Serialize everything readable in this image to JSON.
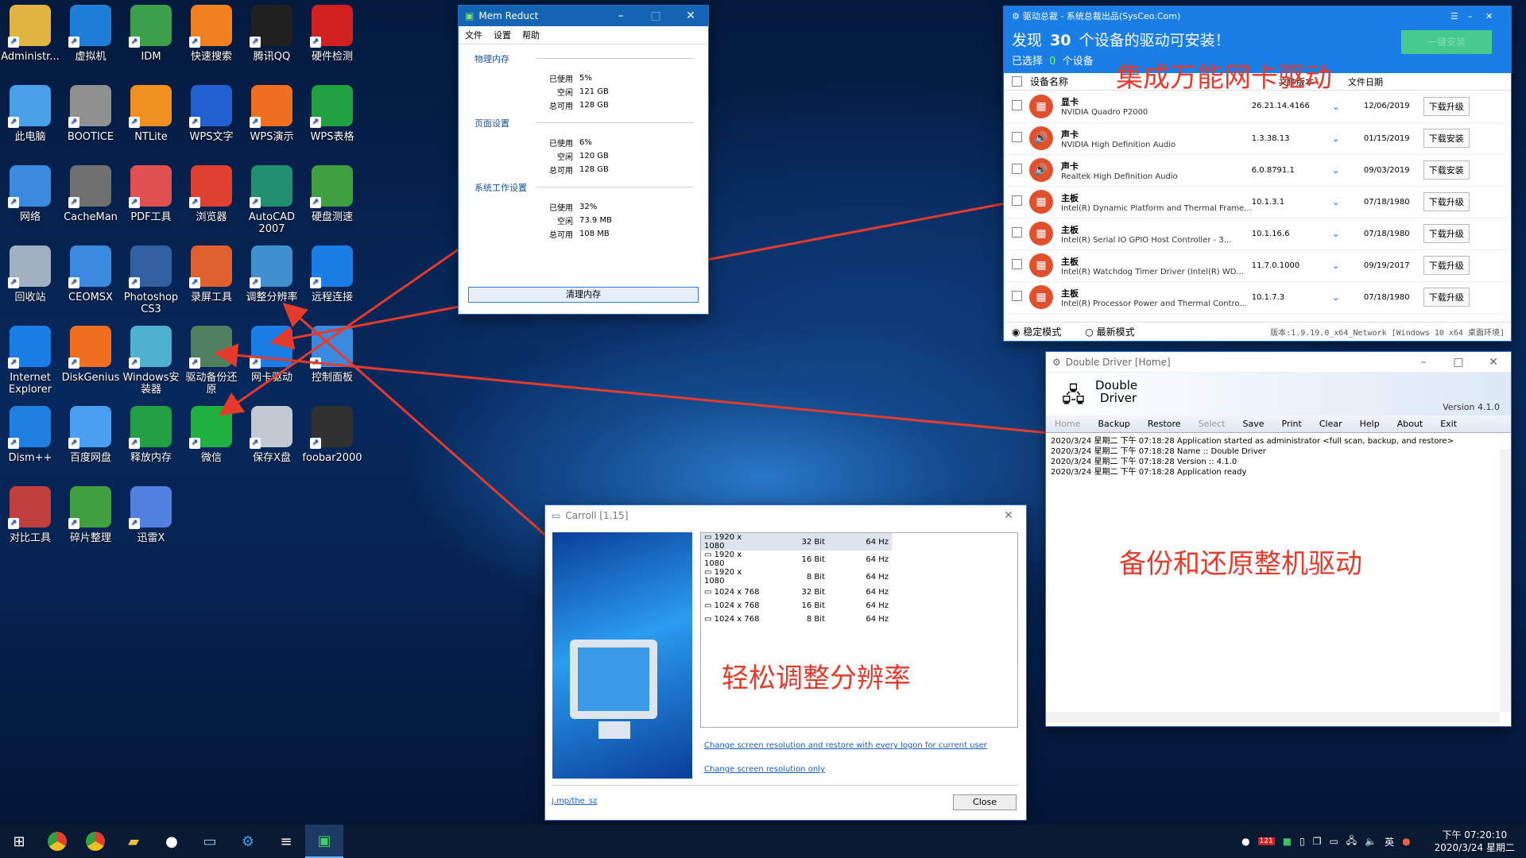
{
  "desktop": {
    "icons": [
      {
        "label": "Administr...",
        "icon": "user-folder-icon",
        "color": "#e0b440"
      },
      {
        "label": "虚拟机",
        "icon": "vmware-icon",
        "color": "#1d7fd8"
      },
      {
        "label": "IDM",
        "icon": "idm-globe-icon",
        "color": "#3aa04a"
      },
      {
        "label": "快速搜索",
        "icon": "search-ring-icon",
        "color": "#f08020"
      },
      {
        "label": "腾讯QQ",
        "icon": "qq-penguin-icon",
        "color": "#202020"
      },
      {
        "label": "硬件检测",
        "icon": "aida64-icon",
        "color": "#d02020"
      },
      {
        "label": "此电脑",
        "icon": "computer-icon",
        "color": "#4aa0e8"
      },
      {
        "label": "BOOTICE",
        "icon": "bootice-icon",
        "color": "#909090"
      },
      {
        "label": "NTLite",
        "icon": "ntlite-icon",
        "color": "#f09020"
      },
      {
        "label": "WPS文字",
        "icon": "wps-writer-icon",
        "color": "#2060d0"
      },
      {
        "label": "WPS演示",
        "icon": "wps-presentation-icon",
        "color": "#f07020"
      },
      {
        "label": "WPS表格",
        "icon": "wps-spreadsheet-icon",
        "color": "#20a040"
      },
      {
        "label": "网络",
        "icon": "network-icon",
        "color": "#3a8ae0"
      },
      {
        "label": "CacheMan",
        "icon": "memory-chip-icon",
        "color": "#707070"
      },
      {
        "label": "PDF工具",
        "icon": "pdf-tools-icon",
        "color": "#e05050"
      },
      {
        "label": "浏览器",
        "icon": "chrome-icon",
        "color": "#e04030"
      },
      {
        "label": "AutoCAD 2007",
        "icon": "autocad-icon",
        "color": "#209070"
      },
      {
        "label": "硬盘测速",
        "icon": "disk-speed-icon",
        "color": "#40a040"
      },
      {
        "label": "回收站",
        "icon": "recycle-bin-icon",
        "color": "#a0b0c0"
      },
      {
        "label": "CEOMSX",
        "icon": "gear-cog-icon",
        "color": "#3a8ae0"
      },
      {
        "label": "Photoshop CS3",
        "icon": "photoshop-icon",
        "color": "#3060a0"
      },
      {
        "label": "录屏工具",
        "icon": "screen-recorder-icon",
        "color": "#e06030"
      },
      {
        "label": "调整分辨率",
        "icon": "monitor-resolution-icon",
        "color": "#4090d0"
      },
      {
        "label": "远程连接",
        "icon": "teamviewer-icon",
        "color": "#1a7ee6"
      },
      {
        "label": "Internet Explorer",
        "icon": "internet-explorer-icon",
        "color": "#1a7ee6"
      },
      {
        "label": "DiskGenius",
        "icon": "diskgenius-icon",
        "color": "#f07020"
      },
      {
        "label": "Windows安装器",
        "icon": "windows-installer-icon",
        "color": "#50b0d0"
      },
      {
        "label": "驱动备份还原",
        "icon": "driver-backup-icon",
        "color": "#508060"
      },
      {
        "label": "网卡驱动",
        "icon": "network-driver-icon",
        "color": "#1a7ee6"
      },
      {
        "label": "控制面板",
        "icon": "control-panel-icon",
        "color": "#3a8ae0"
      },
      {
        "label": "Dism++",
        "icon": "dism-gears-icon",
        "color": "#2080e0"
      },
      {
        "label": "百度网盘",
        "icon": "cloud-drive-icon",
        "color": "#4aa0f0"
      },
      {
        "label": "释放内存",
        "icon": "memory-release-icon",
        "color": "#20a040"
      },
      {
        "label": "微信",
        "icon": "wechat-icon",
        "color": "#20b040"
      },
      {
        "label": "保存X盘",
        "icon": "save-disk-icon",
        "color": "#c0c8d0"
      },
      {
        "label": "foobar2000",
        "icon": "foobar-icon",
        "color": "#303030"
      },
      {
        "label": "对比工具",
        "icon": "compare-tool-icon",
        "color": "#c04040"
      },
      {
        "label": "碎片整理",
        "icon": "defrag-icon",
        "color": "#40a040"
      },
      {
        "label": "迅雷X",
        "icon": "thunder-icon",
        "color": "#5080e0"
      }
    ]
  },
  "mem": {
    "title": "Mem Reduct",
    "menu": [
      "文件",
      "设置",
      "帮助"
    ],
    "sections": [
      {
        "name": "物理内存",
        "rows": [
          [
            "已使用",
            "5%"
          ],
          [
            "空闲",
            "121 GB"
          ],
          [
            "总可用",
            "128 GB"
          ]
        ]
      },
      {
        "name": "页面设置",
        "rows": [
          [
            "已使用",
            "6%"
          ],
          [
            "空闲",
            "120 GB"
          ],
          [
            "总可用",
            "128 GB"
          ]
        ]
      },
      {
        "name": "系统工作设置",
        "rows": [
          [
            "已使用",
            "32%"
          ],
          [
            "空闲",
            "73.9 MB"
          ],
          [
            "总可用",
            "108 MB"
          ]
        ]
      }
    ],
    "button": "清理内存"
  },
  "drv": {
    "title": "驱动总裁 - 系统总裁出品(SysCeo.Com)",
    "headline_pre": "发现",
    "headline_count": "30",
    "headline_post": "个设备的驱动可安装！",
    "selected_pre": "已选择",
    "selected_count": "0",
    "selected_post": "个设备",
    "install_btn": "一键安装",
    "col_name": "设备名称",
    "col_version": "文件版本",
    "col_date": "文件日期",
    "rows": [
      {
        "type": "显卡",
        "name": "NVIDIA Quadro P2000",
        "version": "26.21.14.4166",
        "date": "12/06/2019",
        "action": "下载升级"
      },
      {
        "type": "声卡",
        "name": "NVIDIA High Definition Audio",
        "version": "1.3.38.13",
        "date": "01/15/2019",
        "action": "下载安装"
      },
      {
        "type": "声卡",
        "name": "Realtek High Definition Audio",
        "version": "6.0.8791.1",
        "date": "09/03/2019",
        "action": "下载安装"
      },
      {
        "type": "主板",
        "name": "Intel(R) Dynamic Platform and Thermal Frame...",
        "version": "10.1.3.1",
        "date": "07/18/1980",
        "action": "下载升级"
      },
      {
        "type": "主板",
        "name": "Intel(R) Serial IO GPIO Host Controller - 3...",
        "version": "10.1.16.6",
        "date": "07/18/1980",
        "action": "下载升级"
      },
      {
        "type": "主板",
        "name": "Intel(R) Watchdog Timer Driver (Intel(R) WD...",
        "version": "11.7.0.1000",
        "date": "09/19/2017",
        "action": "下载升级"
      },
      {
        "type": "主板",
        "name": "Intel(R) Processor Power and Thermal Contro...",
        "version": "10.1.7.3",
        "date": "07/18/1980",
        "action": "下载升级"
      }
    ],
    "mode_stable": "稳定模式",
    "mode_latest": "最新模式",
    "version_info": "版本:1.9.19.0_x64_Network [Windows 10 x64 桌面环境]"
  },
  "dd": {
    "title": "Double Driver [Home]",
    "brand_line1": "Double",
    "brand_line2": "Driver",
    "version": "Version 4.1.0",
    "toolbar": [
      "Home",
      "Backup",
      "Restore",
      "Select",
      "Save",
      "Print",
      "Clear",
      "Help",
      "About",
      "Exit"
    ],
    "log": [
      "2020/3/24 星期二 下午 07:18:28  Application started as administrator <full scan, backup, and restore>",
      "2020/3/24 星期二 下午 07:18:28    Name :: Double Driver",
      "2020/3/24 星期二 下午 07:18:28    Version :: 4.1.0",
      "2020/3/24 星期二 下午 07:18:28  Application ready"
    ]
  },
  "car": {
    "title": "Carroll [1.15]",
    "modes": [
      [
        "1920 x 1080",
        "32 Bit",
        "64 Hz"
      ],
      [
        "1920 x 1080",
        "16 Bit",
        "64 Hz"
      ],
      [
        "1920 x 1080",
        "8 Bit",
        "64 Hz"
      ],
      [
        "1024 x 768",
        "32 Bit",
        "64 Hz"
      ],
      [
        "1024 x 768",
        "16 Bit",
        "64 Hz"
      ],
      [
        "1024 x 768",
        "8 Bit",
        "64 Hz"
      ]
    ],
    "link1": "Change screen resolution and restore with every logon for current user",
    "link2": "Change screen resolution only",
    "site": "j.mp/the_sz",
    "close": "Close"
  },
  "annotations": {
    "a1": "集成万能网卡驱动",
    "a2": "备份和还原整机驱动",
    "a3": "轻松调整分辨率"
  },
  "taskbar": {
    "time": "下午 07:20:10",
    "date": "2020/3/24 星期二",
    "ime": "英",
    "tray_badge": "121"
  }
}
